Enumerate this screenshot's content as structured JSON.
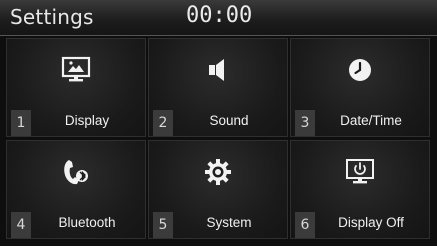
{
  "header": {
    "title": "Settings",
    "clock": "00:00"
  },
  "menu": {
    "items": [
      {
        "number": "1",
        "label": "Display",
        "icon": "display-icon"
      },
      {
        "number": "2",
        "label": "Sound",
        "icon": "speaker-icon"
      },
      {
        "number": "3",
        "label": "Date/Time",
        "icon": "clock-icon"
      },
      {
        "number": "4",
        "label": "Bluetooth",
        "icon": "bluetooth-phone-icon"
      },
      {
        "number": "5",
        "label": "System",
        "icon": "gear-icon"
      },
      {
        "number": "6",
        "label": "Display Off",
        "icon": "display-off-icon"
      }
    ]
  },
  "colors": {
    "background": "#0e0e0e",
    "tile": "#1a1a1a",
    "number_box": "#3b3b3b",
    "text": "#f0f0f0"
  }
}
